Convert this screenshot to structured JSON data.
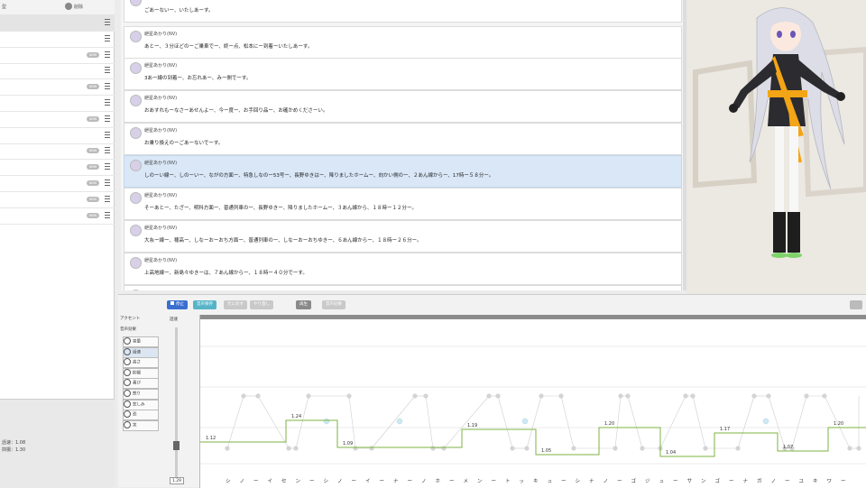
{
  "left_panel": {
    "header_left": "型",
    "header_right": "削除",
    "rows": [
      {
        "badge": ""
      },
      {
        "badge": ""
      },
      {
        "badge": "NEW"
      },
      {
        "badge": ""
      },
      {
        "badge": "NEW"
      },
      {
        "badge": ""
      },
      {
        "badge": "NEW"
      },
      {
        "badge": ""
      },
      {
        "badge": "NEW"
      },
      {
        "badge": "NEW"
      },
      {
        "badge": "NEW"
      },
      {
        "badge": "NEW"
      },
      {
        "badge": "NEW"
      }
    ],
    "footer": {
      "speed": "話速：1.08",
      "pitch": "抑揚：1.30"
    }
  },
  "messages": [
    {
      "name": "紲星あかり(NV)",
      "text": "ごあーないー、いたしあーす。"
    },
    {
      "name": "紲星あかり(NV)",
      "text": "あとー、３分ほどのーご乗車でー、終ー点、松本にー到着ーいたしあーす。"
    },
    {
      "name": "紲星あかり(NV)",
      "text": "3あー線の到着ー、お忘れあー、みー側でーす。"
    },
    {
      "name": "紲星あかり(NV)",
      "text": "おあすれもーなさーあせんよー、今ー度ー、お手回り品ー、お確かめくださーい。"
    },
    {
      "name": "紲星あかり(NV)",
      "text": "お乗り換えのーごあーないでーす。"
    },
    {
      "name": "紲星あかり(NV)",
      "text": "しのーい線ー、しのーいー、ながの方面ー、特急しなのー53号ー、長野ゆきはー、降りましたホームー、向かい側のー、２あん線からー、17時ー５８分ー。"
    },
    {
      "name": "紲星あかり(NV)",
      "text": "そーあとー、たざー、明科方面ー、普通列車のー、長野ゆきー、降りましたホームー、３あん線から、１８時ー１２分ー。"
    },
    {
      "name": "紲星あかり(NV)",
      "text": "大糸ー線ー、穂高ー、しなーおーおち方面ー、普通列車のー、しなーおーおちゆきー、６あん線からー、１８時ー２６分ー。"
    },
    {
      "name": "紲星あかり(NV)",
      "text": "上高地線ー、新島々ゆきーは、７あん線からー、１８時ー４０分でーす。"
    }
  ],
  "toolbar": {
    "stop": "停止",
    "save_audio": "音声保存",
    "undo": "元に戻す",
    "redo": "やり直し",
    "play": "再生",
    "settings": "音声効果"
  },
  "side_menu": {
    "accent": "アクセント",
    "voice_effect": "音声効果",
    "items": [
      "音量",
      "話速",
      "高さ",
      "抑揚",
      "喜び",
      "怒り",
      "悲しみ",
      "恐",
      "笑"
    ]
  },
  "slider": {
    "label": "話速",
    "value": "1.29"
  },
  "graph": {
    "values": [
      "1.12",
      "1.24",
      "1.09",
      "1.19",
      "1.05",
      "1.20",
      "1.04",
      "1.17",
      "1.07",
      "1.20"
    ],
    "kana": [
      "シ",
      "ノ",
      "ー",
      "イ",
      "セ",
      "ン",
      "ー",
      "シ",
      "ノ",
      "ー",
      "イ",
      "ー",
      "ナ",
      "ー",
      "ノ",
      "ホ",
      "ー",
      "メ",
      "ン",
      "ー",
      "ト",
      "ッ",
      "キ",
      "ュ",
      "ー",
      "シ",
      "ナ",
      "ノ",
      "ー",
      "ゴ",
      "ジ",
      "ュ",
      "ー",
      "サ",
      "ン",
      "ゴ",
      "ー",
      "ナ",
      "ガ",
      "ノ",
      "ー",
      "ユ",
      "キ",
      "ワ",
      "ー"
    ]
  },
  "colors": {
    "accent_blue": "#3a7bd5",
    "selection": "#d9e7f7",
    "green_line": "#7cb342"
  }
}
